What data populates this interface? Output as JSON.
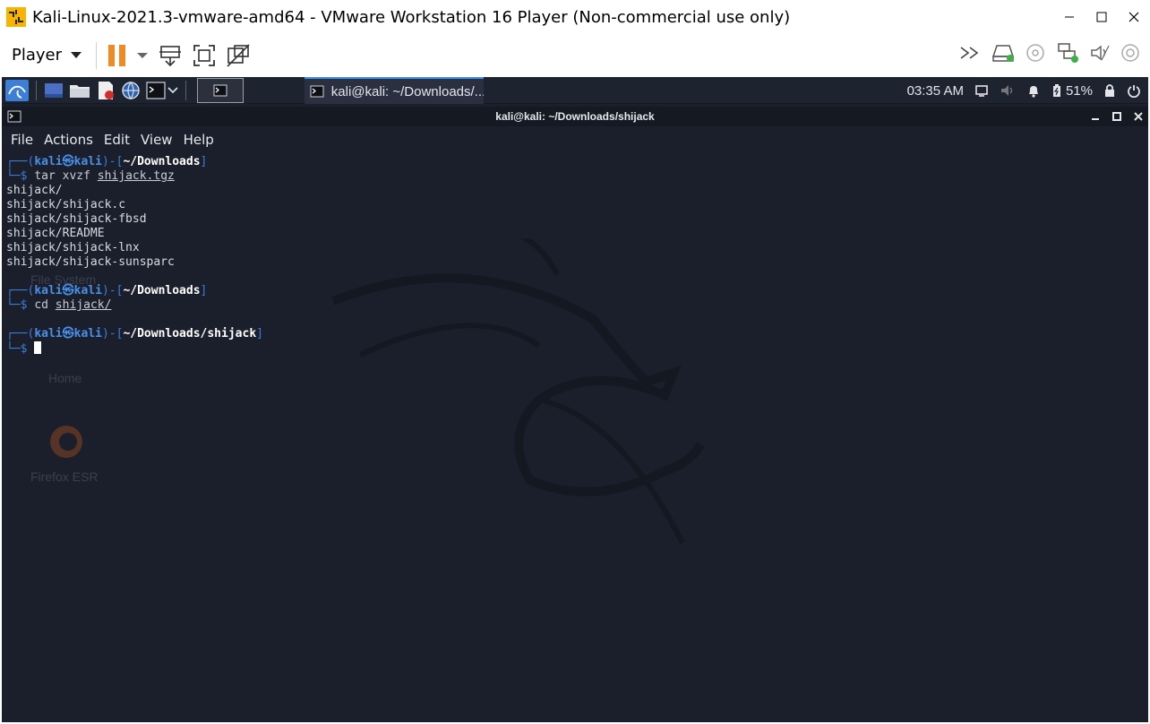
{
  "window": {
    "title": "Kali-Linux-2021.3-vmware-amd64 - VMware Workstation 16 Player (Non-commercial use only)"
  },
  "toolbar": {
    "player_label": "Player"
  },
  "kali_panel": {
    "task_label": "kali@kali: ~/Downloads/...",
    "clock": "03:35 AM",
    "battery": "51%"
  },
  "desktop": {
    "icons": [
      "File System",
      "Home",
      "Firefox ESR"
    ]
  },
  "terminal": {
    "title": "kali@kali: ~/Downloads/shijack",
    "menu": [
      "File",
      "Actions",
      "Edit",
      "View",
      "Help"
    ],
    "prompt_user": "kali",
    "prompt_host": "kali",
    "blocks": [
      {
        "cwd": "~/Downloads",
        "cmd": "tar",
        "args": "xvzf",
        "target": "shijack.tgz",
        "output": [
          "shijack/",
          "shijack/shijack.c",
          "shijack/shijack-fbsd",
          "shijack/README",
          "shijack/shijack-lnx",
          "shijack/shijack-sunsparc"
        ]
      },
      {
        "cwd": "~/Downloads",
        "cmd": "cd",
        "args": "",
        "target": "shijack/",
        "output": []
      },
      {
        "cwd": "~/Downloads/shijack",
        "cmd": "",
        "args": "",
        "target": "",
        "output": []
      }
    ]
  },
  "colors": {
    "accent": "#3f8ee8",
    "terminal_bg": "#1a1f2b",
    "pause_orange": "#f08a24"
  }
}
